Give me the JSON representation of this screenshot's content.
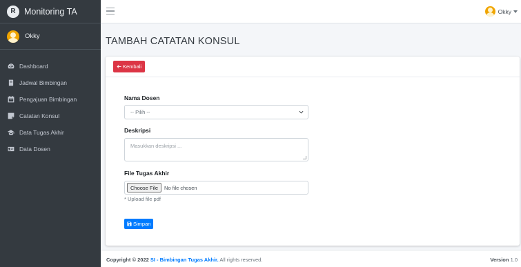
{
  "brand": {
    "title": "Monitoring TA",
    "logo_letter": "R"
  },
  "user": {
    "name": "Okky"
  },
  "sidebar": {
    "items": [
      {
        "label": "Dashboard",
        "icon": "dashboard-icon"
      },
      {
        "label": "Jadwal Bimbingan",
        "icon": "book-icon"
      },
      {
        "label": "Pengajuan Bimbingan",
        "icon": "calendar-icon"
      },
      {
        "label": "Catatan Konsul",
        "icon": "sticky-note-icon"
      },
      {
        "label": "Data Tugas Akhir",
        "icon": "graduation-cap-icon"
      },
      {
        "label": "Data Dosen",
        "icon": "id-card-icon"
      }
    ]
  },
  "page": {
    "title": "TAMBAH CATATAN KONSUL"
  },
  "form": {
    "back_label": "Kembali",
    "dosen_label": "Nama Dosen",
    "dosen_selected": "-- Pilih --",
    "deskripsi_label": "Deskripsi",
    "deskripsi_placeholder": "Masukkan deskripsi ...",
    "file_label": "File Tugas Akhir",
    "choose_file_label": "Choose File",
    "file_status": "No file chosen",
    "file_help": "* Upload file pdf",
    "save_label": "Simpan"
  },
  "footer": {
    "prefix": "Copyright © 2022",
    "link": "SI - Bimbingan Tugas Akhir.",
    "suffix": "All rights reserved.",
    "version_label": "Version",
    "version_number": "1.0"
  },
  "colors": {
    "sidebar_bg": "#343a40",
    "danger": "#dc3545",
    "primary": "#007bff",
    "content_bg": "#f4f6f9"
  }
}
